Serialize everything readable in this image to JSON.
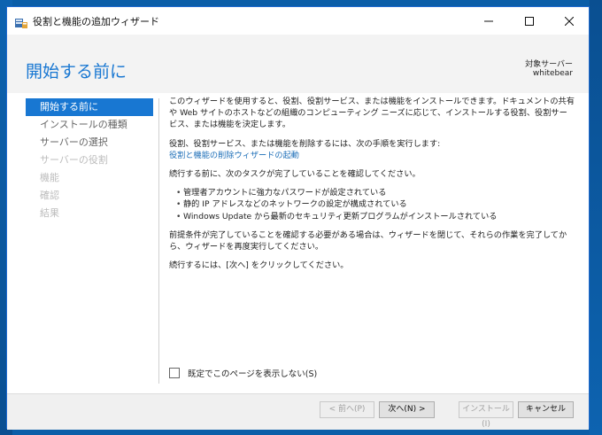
{
  "window": {
    "title": "役割と機能の追加ウィザード"
  },
  "header": {
    "page_title": "開始する前に",
    "server_label": "対象サーバー",
    "server_name": "whitebear"
  },
  "nav": {
    "items": [
      {
        "label": "開始する前に",
        "state": "active"
      },
      {
        "label": "インストールの種類",
        "state": "enabled"
      },
      {
        "label": "サーバーの選択",
        "state": "enabled"
      },
      {
        "label": "サーバーの役割",
        "state": "disabled"
      },
      {
        "label": "機能",
        "state": "disabled"
      },
      {
        "label": "確認",
        "state": "disabled"
      },
      {
        "label": "結果",
        "state": "disabled"
      }
    ]
  },
  "content": {
    "intro": "このウィザードを使用すると、役割、役割サービス、または機能をインストールできます。ドキュメントの共有や Web サイトのホストなどの組織のコンピューティング ニーズに応じて、インストールする役割、役割サービス、または機能を決定します。",
    "remove_text": "役割、役割サービス、または機能を削除するには、次の手順を実行します:",
    "remove_link": "役割と機能の削除ウィザードの起動",
    "confirm_text": "続行する前に、次のタスクが完了していることを確認してください。",
    "bullets": [
      "管理者アカウントに強力なパスワードが設定されている",
      "静的 IP アドレスなどのネットワークの設定が構成されている",
      "Windows Update から最新のセキュリティ更新プログラムがインストールされている"
    ],
    "prereq_text": "前提条件が完了していることを確認する必要がある場合は、ウィザードを閉じて、それらの作業を完了してから、ウィザードを再度実行してください。",
    "continue_text": "続行するには、[次へ] をクリックしてください。"
  },
  "checkbox": {
    "label": "既定でこのページを表示しない(S)",
    "checked": false
  },
  "footer": {
    "prev_label": "< 前へ(P)",
    "next_label": "次へ(N) >",
    "install_label": "インストール(I)",
    "cancel_label": "キャンセル"
  },
  "colors": {
    "accent": "#1877d2",
    "link": "#1e6fb8",
    "desktop": "#0b5ea8"
  }
}
